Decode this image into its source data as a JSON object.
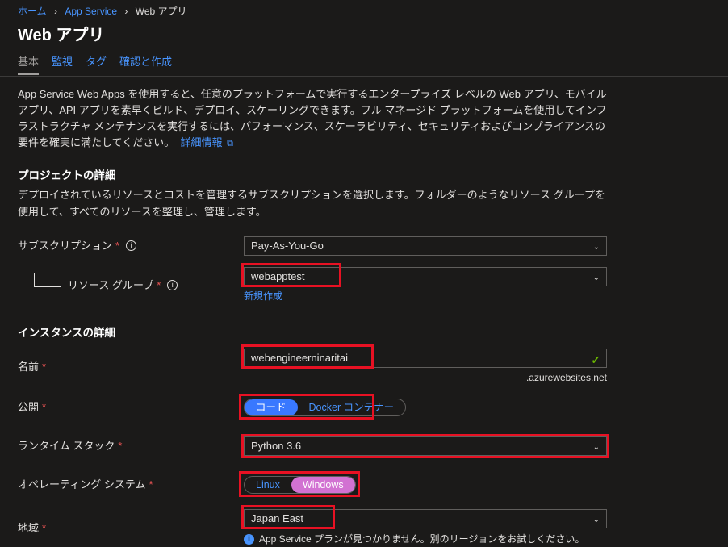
{
  "breadcrumb": {
    "home": "ホーム",
    "app_service": "App Service",
    "web_app": "Web アプリ"
  },
  "title": "Web アプリ",
  "tabs": {
    "basic": "基本",
    "monitoring": "監視",
    "tags": "タグ",
    "review": "確認と作成"
  },
  "intro": {
    "text": "App Service Web Apps を使用すると、任意のプラットフォームで実行するエンタープライズ レベルの Web アプリ、モバイル アプリ、API アプリを素早くビルド、デプロイ、スケーリングできます。フル マネージド プラットフォームを使用してインフラストラクチャ メンテナンスを実行するには、パフォーマンス、スケーラビリティ、セキュリティおよびコンプライアンスの要件を確実に満たしてください。",
    "link": "詳細情報"
  },
  "project": {
    "heading": "プロジェクトの詳細",
    "desc": "デプロイされているリソースとコストを管理するサブスクリプションを選択します。フォルダーのようなリソース グループを使用して、すべてのリソースを整理し、管理します。",
    "subscription_label": "サブスクリプション",
    "subscription_value": "Pay-As-You-Go",
    "rg_label": "リソース グループ",
    "rg_value": "webapptest",
    "new_link": "新規作成"
  },
  "instance": {
    "heading": "インスタンスの詳細",
    "name_label": "名前",
    "name_value": "webengineerninaritai",
    "domain_suffix": ".azurewebsites.net",
    "publish_label": "公開",
    "publish_code": "コード",
    "publish_docker": "Docker コンテナー",
    "runtime_label": "ランタイム スタック",
    "runtime_value": "Python 3.6",
    "os_label": "オペレーティング システム",
    "os_linux": "Linux",
    "os_windows": "Windows",
    "region_label": "地域",
    "region_value": "Japan East",
    "region_info": "App Service プランが見つかりません。別のリージョンをお試しください。"
  }
}
